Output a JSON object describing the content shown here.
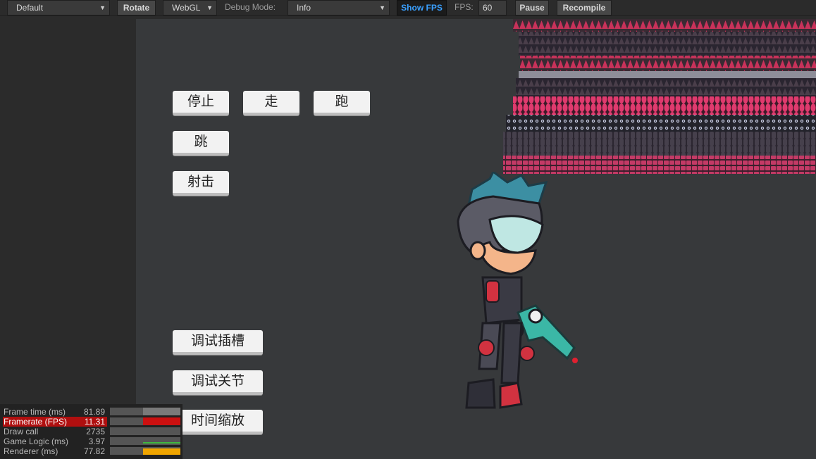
{
  "toolbar": {
    "device_select": "Default",
    "rotate_label": "Rotate",
    "renderer_select": "WebGL",
    "debug_mode_label": "Debug Mode:",
    "debug_mode_select": "Info",
    "show_fps_label": "Show FPS",
    "fps_label": "FPS:",
    "fps_value": "60",
    "pause_label": "Pause",
    "recompile_label": "Recompile"
  },
  "game": {
    "buttons": {
      "stop": "停止",
      "walk": "走",
      "run": "跑",
      "jump": "跳",
      "shoot": "射击",
      "debug_slots": "调试插槽",
      "debug_joints": "调试关节",
      "time_scale": "时间缩放"
    }
  },
  "stats": {
    "rows": [
      {
        "name": "Frame time (ms)",
        "value": "81.89"
      },
      {
        "name": "Framerate (FPS)",
        "value": "11.31"
      },
      {
        "name": "Draw call",
        "value": "2735"
      },
      {
        "name": "Game Logic (ms)",
        "value": "3.97"
      },
      {
        "name": "Renderer (ms)",
        "value": "77.82"
      }
    ]
  },
  "colors": {
    "accent_blue": "#3aa0ff",
    "fps_highlight": "#b00f0f",
    "renderer_bar": "#f0a500"
  }
}
